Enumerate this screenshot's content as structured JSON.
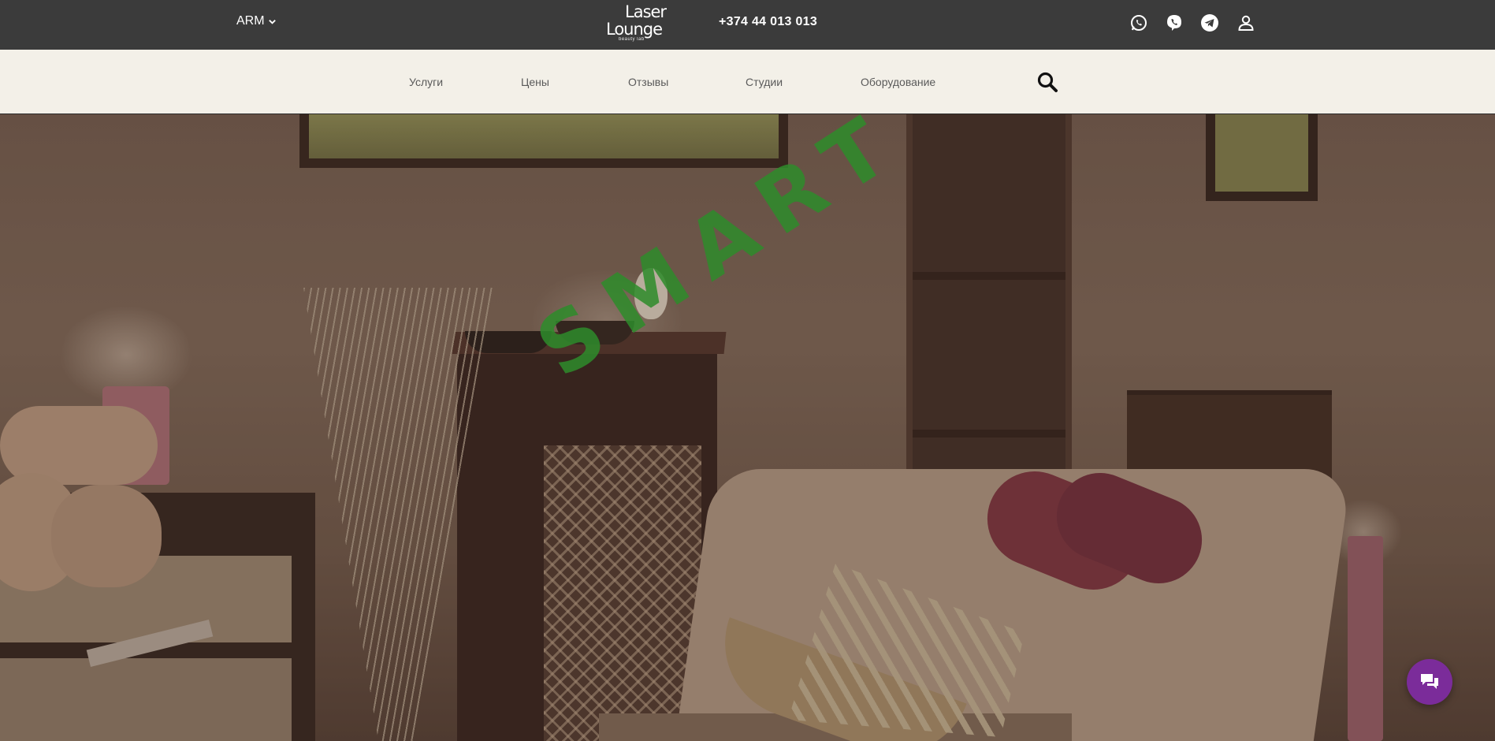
{
  "header": {
    "language": "ARM",
    "logo": {
      "line1": "Laser",
      "line2": "Lounge",
      "tagline": "beauty lab"
    },
    "phone": "+374 44 013 013",
    "icons": [
      "whatsapp-icon",
      "viber-icon",
      "telegram-icon",
      "user-icon"
    ]
  },
  "nav": {
    "items": [
      "Услуги",
      "Цены",
      "Отзывы",
      "Студии",
      "Оборудование"
    ],
    "search_icon": "search-icon"
  },
  "hero": {
    "watermark": "SMART"
  },
  "chat": {
    "icon": "chat-icon"
  },
  "colors": {
    "topbar": "#3b3b3b",
    "navbar": "#f3f0e8",
    "chat": "#7b2c9a",
    "watermark": "#2e8c2b"
  }
}
